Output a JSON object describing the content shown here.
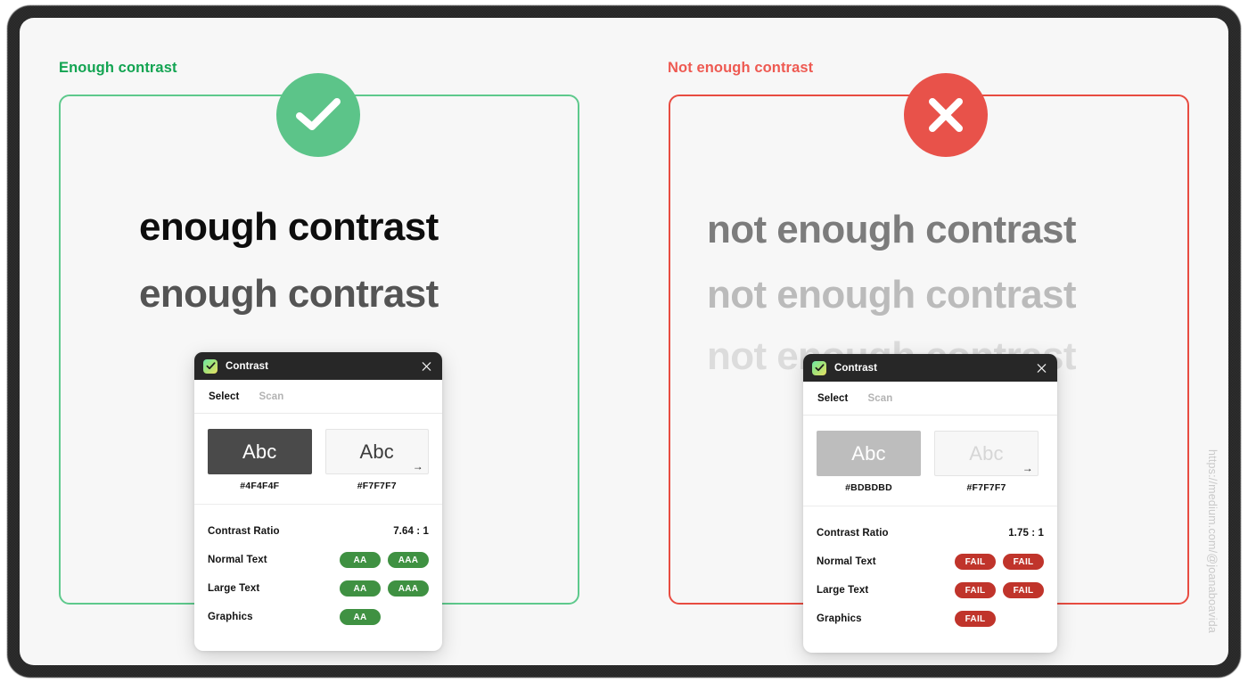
{
  "credit": "https://medium.com/@joanaboavida",
  "panels": [
    {
      "caption": "Enough contrast",
      "status_icon": "check-icon",
      "accent": "#5cc489",
      "border_color": "#5ec98c",
      "caption_color": "#13a452",
      "samples": [
        {
          "text": "enough contrast",
          "color": "#0d0d0d"
        },
        {
          "text": "enough contrast",
          "color": "#545454"
        }
      ],
      "app": {
        "title": "Contrast",
        "icon": "contrast-app-icon",
        "close_icon": "close-icon",
        "tabs": [
          {
            "label": "Select",
            "active": true
          },
          {
            "label": "Scan",
            "active": false
          }
        ],
        "swatches": [
          {
            "sample_text": "Abc",
            "hex": "#4F4F4F",
            "bg": "#4a4a4a",
            "fg": "#ffffff",
            "border": "none",
            "arrow": ""
          },
          {
            "sample_text": "Abc",
            "hex": "#F7F7F7",
            "bg": "#f7f7f7",
            "fg": "#3c3c3c",
            "border": "1px solid #e4e4e4",
            "arrow": "→"
          }
        ],
        "ratio_label": "Contrast Ratio",
        "ratio_value": "7.64 : 1",
        "results": [
          {
            "label": "Normal Text",
            "badges": [
              {
                "text": "AA",
                "state": "pass"
              },
              {
                "text": "AAA",
                "state": "pass"
              }
            ]
          },
          {
            "label": "Large Text",
            "badges": [
              {
                "text": "AA",
                "state": "pass"
              },
              {
                "text": "AAA",
                "state": "pass"
              }
            ]
          },
          {
            "label": "Graphics",
            "badges": [
              {
                "text": "AA",
                "state": "pass"
              }
            ]
          }
        ]
      }
    },
    {
      "caption": "Not enough contrast",
      "status_icon": "cross-icon",
      "accent": "#e8524a",
      "border_color": "#e84c41",
      "caption_color": "#ee5a52",
      "samples": [
        {
          "text": "not enough contrast",
          "color": "#7c7c7c"
        },
        {
          "text": "not enough contrast",
          "color": "#bbbbbb"
        },
        {
          "text": "not enough contrast",
          "color": "#dcdcdc"
        }
      ],
      "app": {
        "title": "Contrast",
        "icon": "contrast-app-icon",
        "close_icon": "close-icon",
        "tabs": [
          {
            "label": "Select",
            "active": true
          },
          {
            "label": "Scan",
            "active": false
          }
        ],
        "swatches": [
          {
            "sample_text": "Abc",
            "hex": "#BDBDBD",
            "bg": "#bdbdbd",
            "fg": "#ffffff",
            "border": "none",
            "arrow": ""
          },
          {
            "sample_text": "Abc",
            "hex": "#F7F7F7",
            "bg": "#f7f7f7",
            "fg": "#d6d6d6",
            "border": "1px solid #e4e4e4",
            "arrow": "→"
          }
        ],
        "ratio_label": "Contrast Ratio",
        "ratio_value": "1.75 : 1",
        "results": [
          {
            "label": "Normal Text",
            "badges": [
              {
                "text": "FAIL",
                "state": "fail"
              },
              {
                "text": "FAIL",
                "state": "fail"
              }
            ]
          },
          {
            "label": "Large Text",
            "badges": [
              {
                "text": "FAIL",
                "state": "fail"
              },
              {
                "text": "FAIL",
                "state": "fail"
              }
            ]
          },
          {
            "label": "Graphics",
            "badges": [
              {
                "text": "FAIL",
                "state": "fail"
              }
            ]
          }
        ]
      }
    }
  ]
}
